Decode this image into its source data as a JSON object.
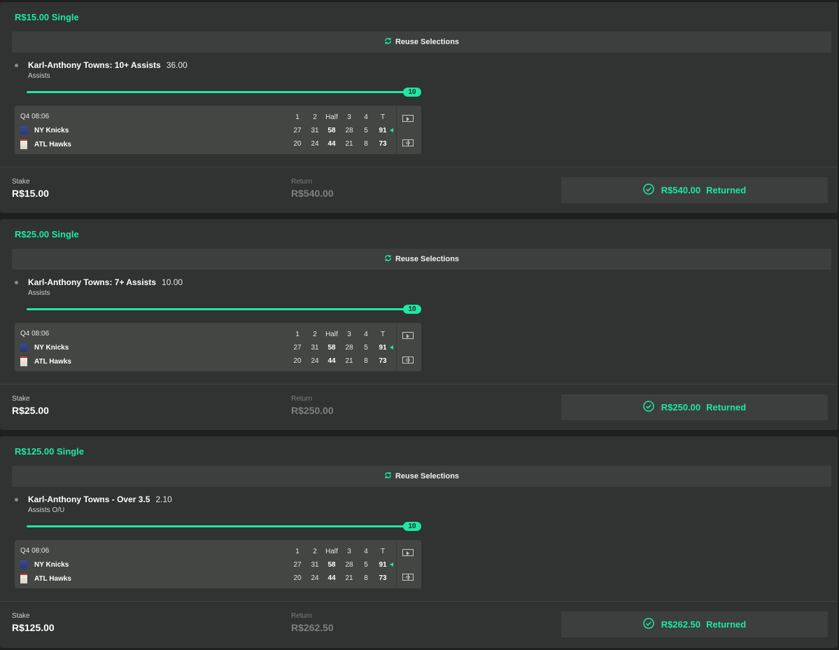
{
  "colors": {
    "accent": "#1ee8a3",
    "card": "#303331",
    "panel": "#434643"
  },
  "icons": {
    "reuse": "refresh-icon",
    "selection": "bullet-dot",
    "play": "play-icon",
    "court": "court-icon",
    "returned": "check-circle-icon"
  },
  "scoreboard_headers": [
    "1",
    "2",
    "Half",
    "3",
    "4",
    "T"
  ],
  "bets": [
    {
      "title": "R$15.00 Single",
      "reuse_label": "Reuse Selections",
      "selection": "Karl-Anthony Towns: 10+ Assists",
      "odds": "36.00",
      "market": "Assists",
      "progress_value": "10",
      "clock": "Q4 08:06",
      "teams": [
        {
          "name": "NY Knicks",
          "scores": [
            "27",
            "31",
            "58",
            "28",
            "5",
            "91"
          ],
          "possession": true
        },
        {
          "name": "ATL Hawks",
          "scores": [
            "20",
            "24",
            "44",
            "21",
            "8",
            "73"
          ],
          "possession": false
        }
      ],
      "stake_label": "Stake",
      "stake": "R$15.00",
      "return_label": "Return",
      "return": "R$540.00",
      "returned_amount": "R$540.00",
      "returned_label": "Returned"
    },
    {
      "title": "R$25.00 Single",
      "reuse_label": "Reuse Selections",
      "selection": "Karl-Anthony Towns: 7+ Assists",
      "odds": "10.00",
      "market": "Assists",
      "progress_value": "10",
      "clock": "Q4 08:06",
      "teams": [
        {
          "name": "NY Knicks",
          "scores": [
            "27",
            "31",
            "58",
            "28",
            "5",
            "91"
          ],
          "possession": true
        },
        {
          "name": "ATL Hawks",
          "scores": [
            "20",
            "24",
            "44",
            "21",
            "8",
            "73"
          ],
          "possession": false
        }
      ],
      "stake_label": "Stake",
      "stake": "R$25.00",
      "return_label": "Return",
      "return": "R$250.00",
      "returned_amount": "R$250.00",
      "returned_label": "Returned"
    },
    {
      "title": "R$125.00 Single",
      "reuse_label": "Reuse Selections",
      "selection": "Karl-Anthony Towns - Over 3.5",
      "odds": "2.10",
      "market": "Assists O/U",
      "progress_value": "10",
      "clock": "Q4 08:06",
      "teams": [
        {
          "name": "NY Knicks",
          "scores": [
            "27",
            "31",
            "58",
            "28",
            "5",
            "91"
          ],
          "possession": true
        },
        {
          "name": "ATL Hawks",
          "scores": [
            "20",
            "24",
            "44",
            "21",
            "8",
            "73"
          ],
          "possession": false
        }
      ],
      "stake_label": "Stake",
      "stake": "R$125.00",
      "return_label": "Return",
      "return": "R$262.50",
      "returned_amount": "R$262.50",
      "returned_label": "Returned"
    }
  ]
}
